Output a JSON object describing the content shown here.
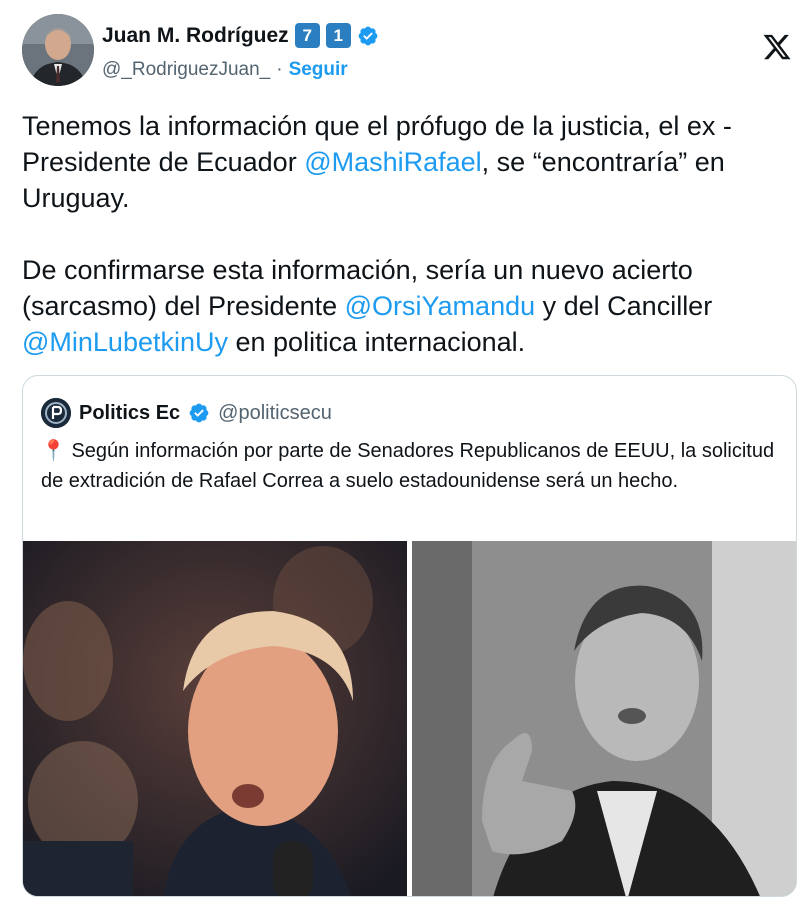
{
  "author": {
    "name": "Juan M. Rodríguez",
    "badge_1": "7",
    "badge_2": "1",
    "handle": "@_RodriguezJuan_",
    "separator": "·",
    "follow_label": "Seguir"
  },
  "tweet": {
    "p1_a": "Tenemos la información que el prófugo de la justicia, el ex - Presidente de Ecuador ",
    "p1_m1": "@MashiRafael",
    "p1_b": ", se “encontraría” en Uruguay.",
    "p2_a": "De confirmarse esta información, sería un nuevo acierto (sarcasmo) del Presidente ",
    "p2_m1": "@OrsiYamandu",
    "p2_b": " y del Canciller ",
    "p2_m2": "@MinLubetkinUy",
    "p2_c": " en politica internacional."
  },
  "quote": {
    "name": "Politics Ec",
    "handle": "@politicsecu",
    "pin_emoji": "📍",
    "text": " Según información por parte de Senadores Republicanos de EEUU, la solicitud de extradición de Rafael Correa a suelo estadounidense será un hecho."
  },
  "colors": {
    "accent": "#1d9bf0",
    "text": "#0f1419",
    "muted": "#536471",
    "border": "#cfd9de"
  },
  "icons": {
    "x_logo": "x-logo-icon",
    "verified": "verified-badge-icon"
  }
}
